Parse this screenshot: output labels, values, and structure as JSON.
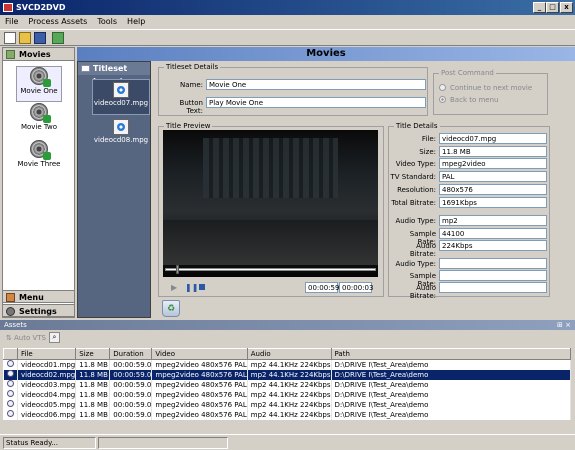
{
  "window": {
    "title": "SVCD2DVD",
    "minimize": "_",
    "maximize": "□",
    "close": "x"
  },
  "menu": [
    "File",
    "Process Assets",
    "Tools",
    "Help"
  ],
  "toolbar_icons": [
    "new-icon",
    "open-icon",
    "save-icon",
    "export-icon"
  ],
  "left": {
    "movies_label": "Movies",
    "movies": [
      "Movie One",
      "Movie Two",
      "Movie Three"
    ],
    "menu_label": "Menu",
    "settings_label": "Settings"
  },
  "header": "Movies",
  "titleset": {
    "label": "Titleset Layout",
    "items": [
      "videocd07.mpg",
      "videocd08.mpg"
    ]
  },
  "titleset_details": {
    "legend": "Titleset Details",
    "name_label": "Name:",
    "name_value": "Movie One",
    "button_label": "Button Text:",
    "button_value": "Play Movie One"
  },
  "post_command": {
    "legend": "Post Command",
    "opt1": "Continue to next movie",
    "opt2": "Back to menu"
  },
  "preview": {
    "legend": "Title Preview",
    "time_current": "00:00:59",
    "time_total": "00:00:03"
  },
  "title_details": {
    "legend": "Title Details",
    "rows": [
      {
        "label": "File:",
        "value": "videocd07.mpg"
      },
      {
        "label": "Size:",
        "value": "11.8 MB"
      },
      {
        "label": "Video Type:",
        "value": "mpeg2video"
      },
      {
        "label": "TV Standard:",
        "value": "PAL"
      },
      {
        "label": "Resolution:",
        "value": "480x576"
      },
      {
        "label": "Total Bitrate:",
        "value": "1691Kbps"
      },
      {
        "label": "Audio Type:",
        "value": "mp2"
      },
      {
        "label": "Sample Rate:",
        "value": "44100"
      },
      {
        "label": "Audio Bitrate:",
        "value": "224Kbps"
      },
      {
        "label": "Audio Type:",
        "value": ""
      },
      {
        "label": "Sample Rate:",
        "value": ""
      },
      {
        "label": "Audio Bitrate:",
        "value": ""
      }
    ]
  },
  "assets": {
    "title": "Assets",
    "pin": "⊞ ×",
    "auto_vts": "Auto VTS",
    "columns": [
      "File",
      "Size",
      "Duration",
      "Video",
      "Audio",
      "Path"
    ],
    "rows": [
      [
        "videocd01.mpg",
        "11.8 MB",
        "00:00:59.0",
        "mpeg2video 480x576 PAL",
        "mp2 44.1KHz 224Kbps",
        "D:\\DRIVE I\\Test_Area\\demo"
      ],
      [
        "videocd02.mpg",
        "11.8 MB",
        "00:00:59.0",
        "mpeg2video 480x576 PAL",
        "mp2 44.1KHz 224Kbps",
        "D:\\DRIVE I\\Test_Area\\demo"
      ],
      [
        "videocd03.mpg",
        "11.8 MB",
        "00:00:59.0",
        "mpeg2video 480x576 PAL",
        "mp2 44.1KHz 224Kbps",
        "D:\\DRIVE I\\Test_Area\\demo"
      ],
      [
        "videocd04.mpg",
        "11.8 MB",
        "00:00:59.0",
        "mpeg2video 480x576 PAL",
        "mp2 44.1KHz 224Kbps",
        "D:\\DRIVE I\\Test_Area\\demo"
      ],
      [
        "videocd05.mpg",
        "11.8 MB",
        "00:00:59.0",
        "mpeg2video 480x576 PAL",
        "mp2 44.1KHz 224Kbps",
        "D:\\DRIVE I\\Test_Area\\demo"
      ],
      [
        "videocd06.mpg",
        "11.8 MB",
        "00:00:59.0",
        "mpeg2video 480x576 PAL",
        "mp2 44.1KHz 224Kbps",
        "D:\\DRIVE I\\Test_Area\\demo"
      ]
    ],
    "selected_row": 1
  },
  "status": "Status Ready..."
}
